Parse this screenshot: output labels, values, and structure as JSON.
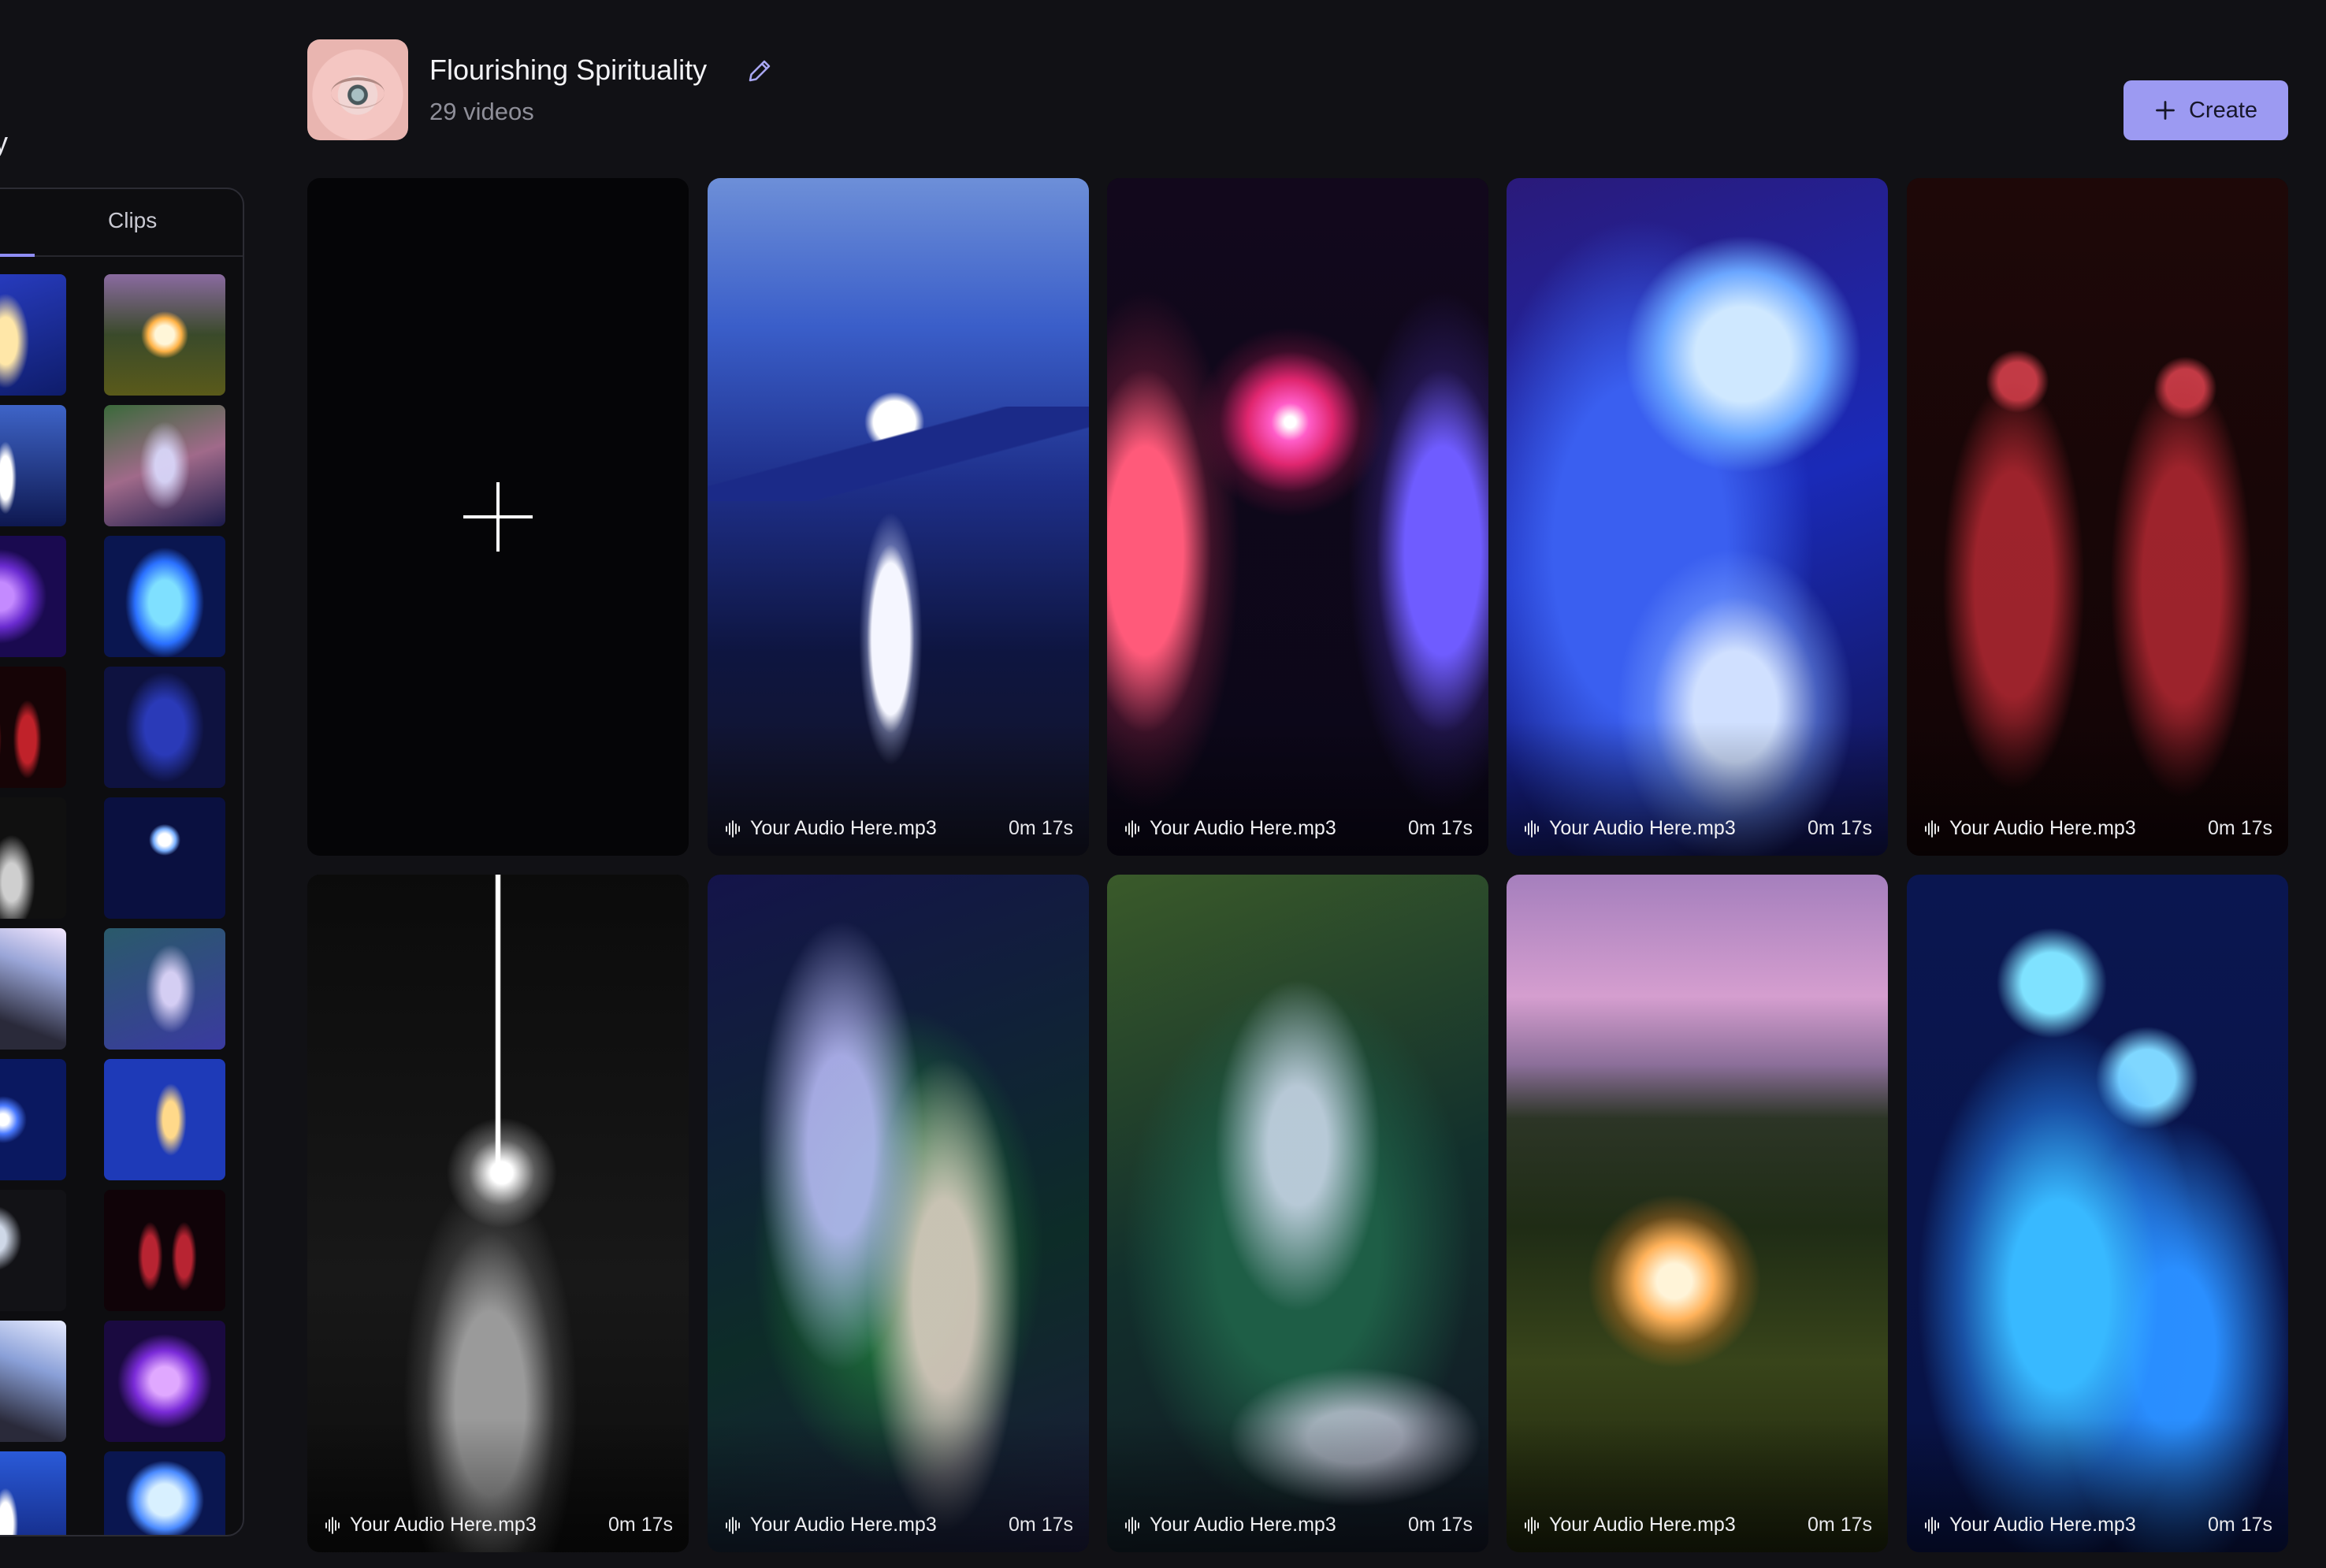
{
  "sidebar": {
    "title_fragment": "y",
    "tab_label": "Clips",
    "clips": [
      "clip-a",
      "clip-b",
      "clip-c",
      "clip-d",
      "clip-e",
      "clip-f",
      "clip-g",
      "clip-h",
      "clip-i",
      "clip-j",
      "clip-k",
      "clip-l",
      "clip-m",
      "clip-n",
      "clip-o",
      "clip-p",
      "clip-q",
      "clip-r",
      "clip-s",
      "clip-t"
    ]
  },
  "header": {
    "title": "Flourishing Spirituality",
    "subtitle": "29 videos",
    "create_label": "Create"
  },
  "videos": [
    {
      "audio": "Your Audio Here.mp3",
      "duration": "0m 17s"
    },
    {
      "audio": "Your Audio Here.mp3",
      "duration": "0m 17s"
    },
    {
      "audio": "Your Audio Here.mp3",
      "duration": "0m 17s"
    },
    {
      "audio": "Your Audio Here.mp3",
      "duration": "0m 17s"
    },
    {
      "audio": "Your Audio Here.mp3",
      "duration": "0m 17s"
    },
    {
      "audio": "Your Audio Here.mp3",
      "duration": "0m 17s"
    },
    {
      "audio": "Your Audio Here.mp3",
      "duration": "0m 17s"
    },
    {
      "audio": "Your Audio Here.mp3",
      "duration": "0m 17s"
    },
    {
      "audio": "Your Audio Here.mp3",
      "duration": "0m 17s"
    }
  ],
  "icons": {
    "edit": "pencil-icon",
    "create": "plus-icon",
    "add_video": "plus-icon",
    "audio": "waveform-icon"
  },
  "colors": {
    "background": "#111115",
    "accent": "#9c9af2",
    "tab_indicator": "#8f8df5"
  }
}
